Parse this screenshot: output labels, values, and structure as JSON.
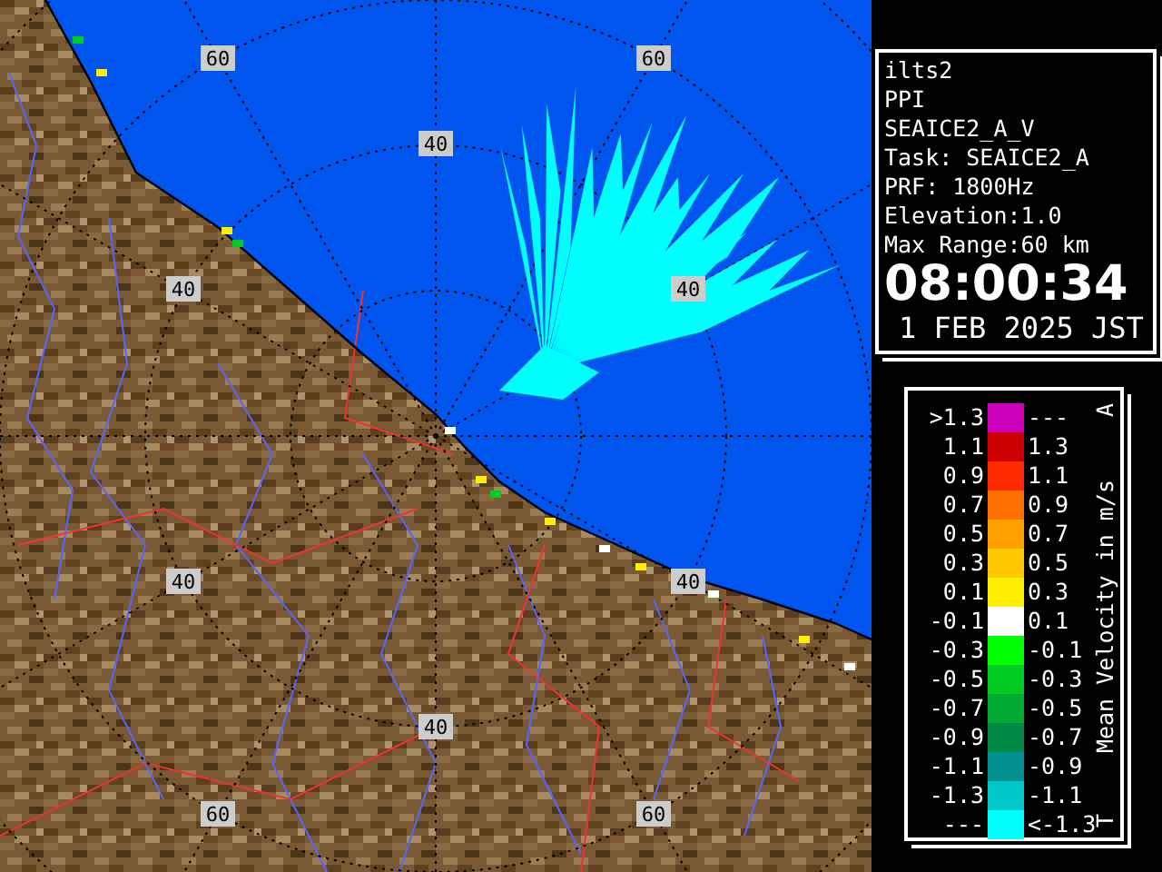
{
  "map": {
    "range_labels": [
      "60",
      "60",
      "40",
      "40",
      "40",
      "40",
      "40",
      "40",
      "60",
      "60"
    ]
  },
  "radar_info": {
    "site": "ilts2",
    "product": "PPI",
    "scan": "SEAICE2_A_V",
    "task": "Task: SEAICE2_A",
    "prf": "PRF: 1800Hz",
    "elevation": "Elevation:1.0",
    "max_range": "Max Range:60 km",
    "time": "08:00:34",
    "date": "1 FEB 2025 JST"
  },
  "legend": {
    "top_mark": "A",
    "title": "Mean Velocity in m/s",
    "bottom_mark": "T",
    "bins": [
      {
        "label": ">1.3",
        "upper": "---",
        "color": "#cc00bb"
      },
      {
        "label": "1.1",
        "upper": "1.3",
        "color": "#cc0000"
      },
      {
        "label": "0.9",
        "upper": "1.1",
        "color": "#ff2a00"
      },
      {
        "label": "0.7",
        "upper": "0.9",
        "color": "#ff7000"
      },
      {
        "label": "0.5",
        "upper": "0.7",
        "color": "#ffa000"
      },
      {
        "label": "0.3",
        "upper": "0.5",
        "color": "#ffc800"
      },
      {
        "label": "0.1",
        "upper": "0.3",
        "color": "#ffee00"
      },
      {
        "label": "-0.1",
        "upper": "0.1",
        "color": "#ffffff"
      },
      {
        "label": "-0.3",
        "upper": "-0.1",
        "color": "#00ff00"
      },
      {
        "label": "-0.5",
        "upper": "-0.3",
        "color": "#00cc22"
      },
      {
        "label": "-0.7",
        "upper": "-0.5",
        "color": "#00aa33"
      },
      {
        "label": "-0.9",
        "upper": "-0.7",
        "color": "#008844"
      },
      {
        "label": "-1.1",
        "upper": "-0.9",
        "color": "#009090"
      },
      {
        "label": "-1.3",
        "upper": "-1.1",
        "color": "#00c8c8"
      },
      {
        "label": "---",
        "upper": "<-1.3",
        "color": "#00ffff"
      }
    ]
  }
}
